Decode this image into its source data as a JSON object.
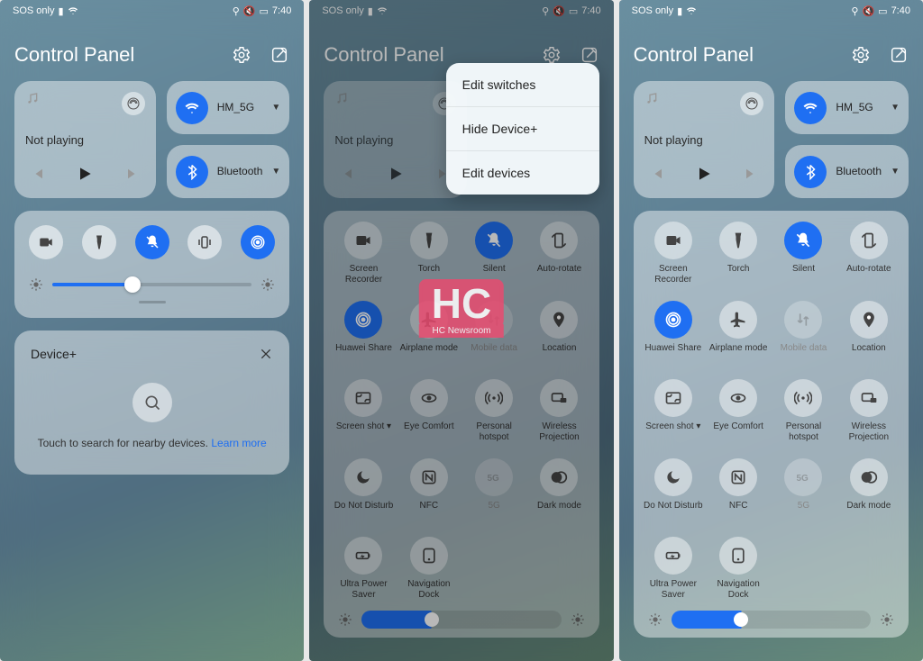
{
  "status": {
    "left": "SOS only",
    "time": "7:40"
  },
  "header": {
    "title": "Control Panel"
  },
  "media": {
    "status": "Not playing"
  },
  "conn": {
    "wifi": {
      "label": "HM_5G"
    },
    "bt": {
      "label": "Bluetooth"
    }
  },
  "device": {
    "title": "Device+",
    "hint": "Touch to search for nearby devices.",
    "learn": "Learn more"
  },
  "dropdown": {
    "edit_switches": "Edit switches",
    "hide_device": "Hide Device+",
    "edit_devices": "Edit devices"
  },
  "toggles": {
    "screen_rec": "Screen Recorder",
    "torch": "Torch",
    "silent": "Silent",
    "autorotate": "Auto-rotate",
    "hshare": "Huawei Share",
    "airplane": "Airplane mode",
    "mdata": "Mobile data",
    "location": "Location",
    "sshot": "Screen shot",
    "eye": "Eye Comfort",
    "hotspot": "Personal hotspot",
    "wproj": "Wireless Projection",
    "dnd": "Do Not Disturb",
    "nfc": "NFC",
    "fiveg": "5G",
    "dark": "Dark mode",
    "ups": "Ultra Power Saver",
    "navdock": "Navigation Dock"
  },
  "watermark": {
    "main": "HC",
    "sub": "HC Newsroom"
  }
}
